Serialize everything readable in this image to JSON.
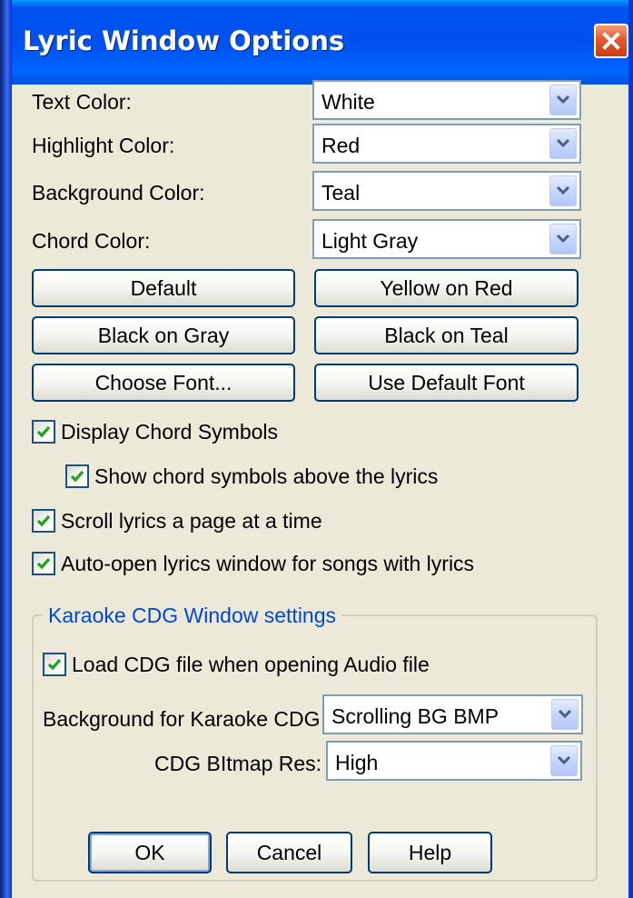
{
  "window": {
    "title": "Lyric Window Options"
  },
  "colors": {
    "text_color": {
      "label": "Text Color:",
      "value": "White"
    },
    "highlight_color": {
      "label": "Highlight Color:",
      "value": "Red"
    },
    "background_color": {
      "label": "Background Color:",
      "value": "Teal"
    },
    "chord_color": {
      "label": "Chord Color:",
      "value": "Light Gray"
    }
  },
  "preset_buttons": {
    "default": "Default",
    "yellow_on_red": "Yellow on Red",
    "black_on_gray": "Black on Gray",
    "black_on_teal": "Black on Teal",
    "choose_font": "Choose Font...",
    "use_default_font": "Use Default Font"
  },
  "options": {
    "display_chord_symbols": {
      "label": "Display Chord Symbols",
      "checked": true
    },
    "show_chords_above": {
      "label": "Show chord symbols above the lyrics",
      "checked": true
    },
    "scroll_page": {
      "label": "Scroll lyrics a page at a time",
      "checked": true
    },
    "auto_open": {
      "label": "Auto-open lyrics window for songs with lyrics",
      "checked": true
    }
  },
  "karaoke": {
    "group_title": "Karaoke CDG Window settings",
    "load_cdg": {
      "label": "Load CDG file when opening Audio file",
      "checked": true
    },
    "background": {
      "label": "Background for Karaoke CDG",
      "value": "Scrolling BG BMP"
    },
    "bitmap_res": {
      "label": "CDG BItmap Res:",
      "value": "High"
    }
  },
  "footer": {
    "ok": "OK",
    "cancel": "Cancel",
    "help": "Help"
  },
  "icons": {
    "close": "close-icon",
    "dropdown": "chevron-down-icon",
    "check": "checkmark-icon"
  }
}
